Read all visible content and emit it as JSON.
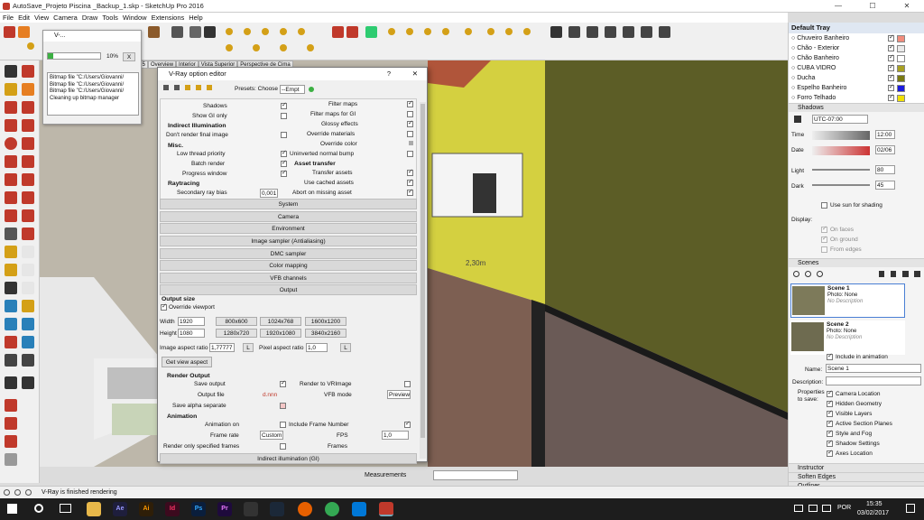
{
  "app": {
    "title": "AutoSave_Projeto Piscina _Backup_1.skp - SketchUp Pro 2016",
    "window_controls": [
      "—",
      "☐",
      "✕"
    ]
  },
  "menu": [
    "File",
    "Edit",
    "View",
    "Camera",
    "Draw",
    "Tools",
    "Window",
    "Extensions",
    "Help"
  ],
  "scene_tabs": [
    "ene 5",
    "Overview",
    "Interior",
    "Vista Superior",
    "Perspective de Cima"
  ],
  "progress_dialog": {
    "title": "V-...",
    "percent": "10%",
    "close": "X",
    "log": [
      "Bitmap file \"C:/Users/Giovanni/",
      "Bitmap file \"C:/Users/Giovanni/",
      "Bitmap file \"C:/Users/Giovanni/",
      "Cleaning up bitmap manager"
    ]
  },
  "vray": {
    "title": "V-Ray option editor",
    "help": "?",
    "close": "✕",
    "presets_label": "Presets: Choose",
    "presets_value": "--Empt",
    "left_col": [
      {
        "label": "Shadows",
        "checked": true
      },
      {
        "label": "Show GI only",
        "checked": false
      }
    ],
    "indirect_hdr": "Indirect Illumination",
    "dont_render": "Don't render final image",
    "misc_hdr": "Misc.",
    "misc": [
      {
        "label": "Low thread priority",
        "checked": true
      },
      {
        "label": "Batch render",
        "checked": true
      },
      {
        "label": "Progress window",
        "checked": true
      }
    ],
    "raytracing_hdr": "Raytracing",
    "secondary_bias": "Secondary ray bias",
    "secondary_bias_value": "0,001",
    "right_col": [
      {
        "label": "Filter maps",
        "checked": true
      },
      {
        "label": "Filter maps for GI",
        "checked": false
      },
      {
        "label": "Glossy effects",
        "checked": true
      },
      {
        "label": "Override materials",
        "checked": false
      },
      {
        "label": "Override color",
        "checked": false
      },
      {
        "label": "Uninverted normal bump",
        "checked": false
      }
    ],
    "asset_hdr": "Asset transfer",
    "asset": [
      {
        "label": "Transfer assets",
        "checked": true
      },
      {
        "label": "Use cached assets",
        "checked": true
      },
      {
        "label": "Abort on missing asset",
        "checked": true
      }
    ],
    "rollouts": [
      "System",
      "Camera",
      "Environment",
      "Image sampler (Antialiasing)",
      "DMC sampler",
      "Color mapping",
      "VFB channels",
      "Output"
    ],
    "output_size_hdr": "Output size",
    "override_viewport": "Override viewport",
    "width_label": "Width",
    "width": "1920",
    "height_label": "Height",
    "height": "1080",
    "presets": [
      "800x600",
      "1024x768",
      "1600x1200",
      "1280x720",
      "1920x1080",
      "3840x2160"
    ],
    "aspect_label": "Image aspect ratio",
    "aspect": "1,77777",
    "L": "L",
    "pixel_aspect_label": "Pixel aspect ratio",
    "pixel_aspect": "1,0",
    "get_view_aspect": "Get view aspect",
    "render_output_hdr": "Render Output",
    "save_output": "Save output",
    "render_to_vrimage": "Render to VRImage",
    "output_file": "Output file",
    "output_file_value": "d.nnn",
    "vfb_mode": "VFB mode",
    "vfb_mode_value": "Preview",
    "save_alpha": "Save alpha separate",
    "animation_hdr": "Animation",
    "animation_on": "Animation on",
    "include_frame": "Include Frame Number",
    "frame_rate": "Frame rate",
    "frame_rate_value": "Custom",
    "fps": "FPS",
    "fps_value": "1,0",
    "only_specified": "Render only specified frames",
    "frames": "Frames",
    "bottom_rollout": "Indirect illumination (GI)"
  },
  "tray": {
    "title": "Default Tray",
    "materials": [
      {
        "name": "Chuveiro Banheiro",
        "color": "#f28c7c"
      },
      {
        "name": "Chão - Exterior",
        "color": "#eaeaea"
      },
      {
        "name": "Chão Banheiro",
        "color": "#ffffff"
      },
      {
        "name": "CUBA VIDRO",
        "color": "#a8a020"
      },
      {
        "name": "Ducha",
        "color": "#7a7a10"
      },
      {
        "name": "Espelho Banheiro",
        "color": "#1a1ae0"
      },
      {
        "name": "Forro Telhado",
        "color": "#f0e000"
      }
    ],
    "shadows": {
      "title": "Shadows",
      "tz": "UTC-07:00",
      "time_label": "Time",
      "time": "12:00",
      "date_label": "Date",
      "date": "02/06",
      "light_label": "Light",
      "light": "80",
      "dark_label": "Dark",
      "dark": "45",
      "use_sun": "Use sun for shading",
      "display": "Display:",
      "on_faces": "On faces",
      "on_ground": "On ground",
      "from_edges": "From edges"
    },
    "scenes": {
      "title": "Scenes",
      "items": [
        {
          "name": "Scene 1",
          "photo": "Photo: None",
          "desc": "No Description"
        },
        {
          "name": "Scene 2",
          "photo": "Photo: None",
          "desc": "No Description"
        }
      ],
      "include": "Include in animation",
      "name_label": "Name:",
      "name_value": "Scene 1",
      "desc_label": "Description:",
      "props_label": "Properties to save:",
      "props": [
        "Camera Location",
        "Hidden Geometry",
        "Visible Layers",
        "Active Section Planes",
        "Style and Fog",
        "Shadow Settings",
        "Axes Location"
      ]
    },
    "collapsed": [
      "Instructor",
      "Soften Edges",
      "Outliner"
    ]
  },
  "status": {
    "text": "V-Ray is finished rendering",
    "measurements": "Measurements"
  },
  "viewport": {
    "dimension": "2,30m"
  },
  "taskbar": {
    "lang": "POR",
    "time": "15:35",
    "date": "03/02/2017"
  }
}
